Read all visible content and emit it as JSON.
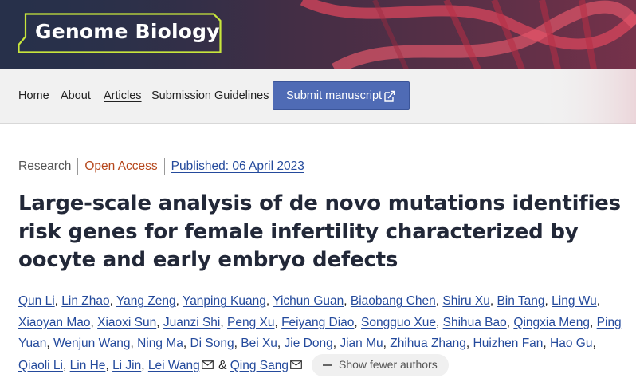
{
  "journal": {
    "name": "Genome Biology"
  },
  "nav": {
    "items": [
      "Home",
      "About",
      "Articles",
      "Submission Guidelines"
    ],
    "active": "Articles",
    "submit_label": "Submit manuscript"
  },
  "article": {
    "type": "Research",
    "access": "Open Access",
    "published": "Published: 06 April 2023",
    "title_lines": [
      "Large-scale analysis of de novo mutations identifies",
      "risk genes for female infertility characterized by",
      "oocyte and early embryo defects"
    ]
  },
  "authors": {
    "lines": [
      [
        "Qun Li",
        "Lin Zhao",
        "Yang Zeng",
        "Yanping Kuang",
        "Yichun Guan",
        "Biaobang Chen",
        "Shiru Xu",
        "Bin Tang",
        "Ling Wu"
      ],
      [
        "Xiaoyan Mao",
        "Xiaoxi Sun",
        "Juanzi Shi",
        "Peng Xu",
        "Feiyang Diao",
        "Songguo Xue",
        "Shihua Bao",
        "Qingxia Meng",
        "Ping"
      ],
      [
        "Yuan",
        "Wenjun Wang",
        "Ning Ma",
        "Di Song",
        "Bei Xu",
        "Jie Dong",
        "Jian Mu",
        "Zhihua Zhang",
        "Huizhen Fan",
        "Hao Gu"
      ],
      [
        "Qiaoli Li",
        "Lin He",
        "Li Jin",
        "Lei Wang",
        "Qing Sang"
      ]
    ],
    "show_fewer_label": "Show fewer authors"
  },
  "colors": {
    "header_bg": "#27304a",
    "logo_outline": "#c8e63c",
    "link": "#244a9c",
    "open_access": "#b5471c",
    "button": "#4f6bb5"
  },
  "icons": [
    "external-link-icon",
    "envelope-icon",
    "minus-icon"
  ]
}
